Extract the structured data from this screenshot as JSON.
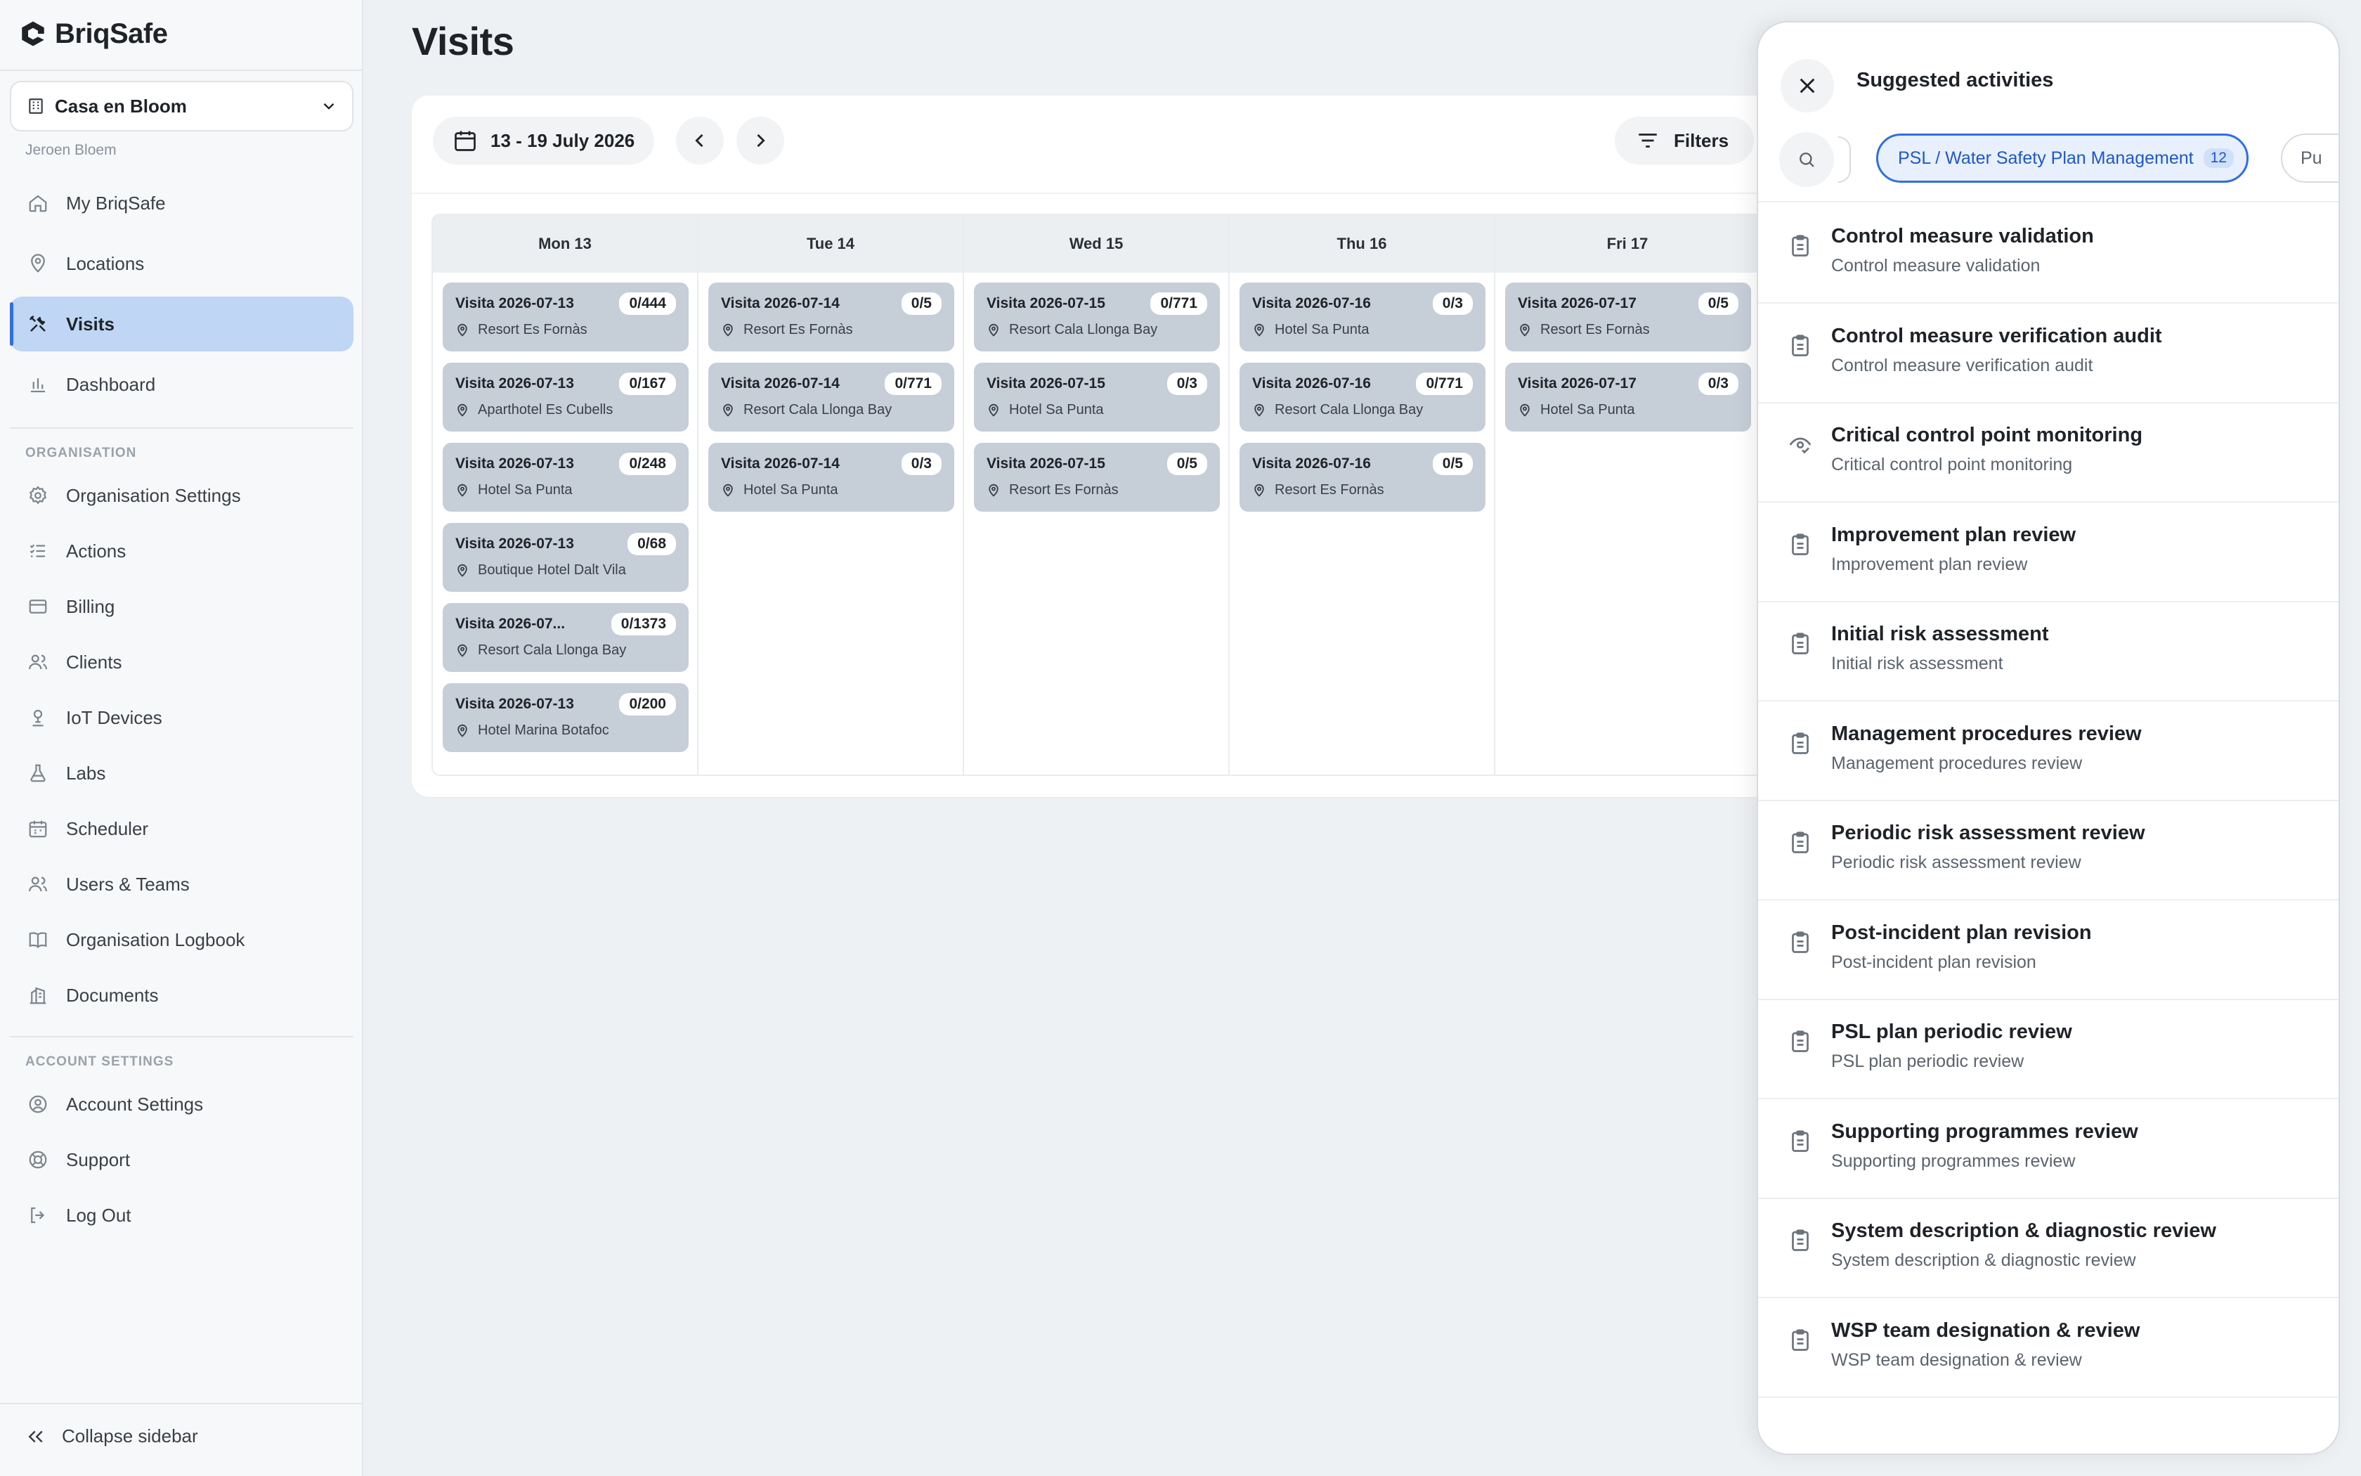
{
  "brand": {
    "name": "BriqSafe"
  },
  "org_switcher": {
    "name": "Casa en Bloom",
    "user": "Jeroen Bloem"
  },
  "nav": {
    "main": [
      {
        "label": "My BriqSafe",
        "icon": "home-icon"
      },
      {
        "label": "Locations",
        "icon": "map-pin-icon"
      },
      {
        "label": "Visits",
        "icon": "tools-icon",
        "active": true
      },
      {
        "label": "Dashboard",
        "icon": "bar-chart-icon"
      }
    ],
    "org_section": "ORGANISATION",
    "org": [
      {
        "label": "Organisation Settings",
        "icon": "gear-icon"
      },
      {
        "label": "Actions",
        "icon": "list-check-icon"
      },
      {
        "label": "Billing",
        "icon": "credit-card-icon"
      },
      {
        "label": "Clients",
        "icon": "users-icon"
      },
      {
        "label": "IoT Devices",
        "icon": "sensor-icon"
      },
      {
        "label": "Labs",
        "icon": "flask-icon"
      },
      {
        "label": "Scheduler",
        "icon": "calendar-icon"
      },
      {
        "label": "Users & Teams",
        "icon": "users-icon"
      },
      {
        "label": "Organisation Logbook",
        "icon": "book-icon"
      },
      {
        "label": "Documents",
        "icon": "building-icon"
      }
    ],
    "account_section": "ACCOUNT SETTINGS",
    "account": [
      {
        "label": "Account Settings",
        "icon": "user-circle-icon"
      },
      {
        "label": "Support",
        "icon": "lifebuoy-icon"
      },
      {
        "label": "Log Out",
        "icon": "logout-icon"
      }
    ],
    "collapse_label": "Collapse sidebar"
  },
  "page": {
    "title": "Visits"
  },
  "toolbar": {
    "date_range": "13 - 19 July 2026",
    "filters_label": "Filters"
  },
  "calendar": {
    "days": [
      {
        "label": "Mon 13",
        "visits": [
          {
            "title": "Visita 2026-07-13",
            "count": "0/444",
            "location": "Resort Es Fornàs"
          },
          {
            "title": "Visita 2026-07-13",
            "count": "0/167",
            "location": "Aparthotel Es Cubells"
          },
          {
            "title": "Visita 2026-07-13",
            "count": "0/248",
            "location": "Hotel Sa Punta"
          },
          {
            "title": "Visita 2026-07-13",
            "count": "0/68",
            "location": "Boutique Hotel Dalt Vila"
          },
          {
            "title": "Visita 2026-07...",
            "count": "0/1373",
            "location": "Resort Cala Llonga Bay"
          },
          {
            "title": "Visita 2026-07-13",
            "count": "0/200",
            "location": "Hotel Marina Botafoc"
          }
        ]
      },
      {
        "label": "Tue 14",
        "visits": [
          {
            "title": "Visita 2026-07-14",
            "count": "0/5",
            "location": "Resort Es Fornàs"
          },
          {
            "title": "Visita 2026-07-14",
            "count": "0/771",
            "location": "Resort Cala Llonga Bay"
          },
          {
            "title": "Visita 2026-07-14",
            "count": "0/3",
            "location": "Hotel Sa Punta"
          }
        ]
      },
      {
        "label": "Wed 15",
        "visits": [
          {
            "title": "Visita 2026-07-15",
            "count": "0/771",
            "location": "Resort Cala Llonga Bay"
          },
          {
            "title": "Visita 2026-07-15",
            "count": "0/3",
            "location": "Hotel Sa Punta"
          },
          {
            "title": "Visita 2026-07-15",
            "count": "0/5",
            "location": "Resort Es Fornàs"
          }
        ]
      },
      {
        "label": "Thu 16",
        "visits": [
          {
            "title": "Visita 2026-07-16",
            "count": "0/3",
            "location": "Hotel Sa Punta"
          },
          {
            "title": "Visita 2026-07-16",
            "count": "0/771",
            "location": "Resort Cala Llonga Bay"
          },
          {
            "title": "Visita 2026-07-16",
            "count": "0/5",
            "location": "Resort Es Fornàs"
          }
        ]
      },
      {
        "label": "Fri 17",
        "visits": [
          {
            "title": "Visita 2026-07-17",
            "count": "0/5",
            "location": "Resort Es Fornàs"
          },
          {
            "title": "Visita 2026-07-17",
            "count": "0/3",
            "location": "Hotel Sa Punta"
          }
        ]
      }
    ]
  },
  "panel": {
    "title": "Suggested activities",
    "filter_pill": {
      "label": "PSL / Water Safety Plan Management",
      "count": "12"
    },
    "next_pill_label": "Pu",
    "activities": [
      {
        "title": "Control measure validation",
        "subtitle": "Control measure validation",
        "icon": "clipboard-icon"
      },
      {
        "title": "Control measure verification audit",
        "subtitle": "Control measure verification audit",
        "icon": "clipboard-icon"
      },
      {
        "title": "Critical control point monitoring",
        "subtitle": "Critical control point monitoring",
        "icon": "eye-check-icon"
      },
      {
        "title": "Improvement plan review",
        "subtitle": "Improvement plan review",
        "icon": "clipboard-icon"
      },
      {
        "title": "Initial risk assessment",
        "subtitle": "Initial risk assessment",
        "icon": "clipboard-icon"
      },
      {
        "title": "Management procedures review",
        "subtitle": "Management procedures review",
        "icon": "clipboard-icon"
      },
      {
        "title": "Periodic risk assessment review",
        "subtitle": "Periodic risk assessment review",
        "icon": "clipboard-icon"
      },
      {
        "title": "Post-incident plan revision",
        "subtitle": "Post-incident plan revision",
        "icon": "clipboard-icon"
      },
      {
        "title": "PSL plan periodic review",
        "subtitle": "PSL plan periodic review",
        "icon": "clipboard-icon"
      },
      {
        "title": "Supporting programmes review",
        "subtitle": "Supporting programmes review",
        "icon": "clipboard-icon"
      },
      {
        "title": "System description & diagnostic review",
        "subtitle": "System description & diagnostic review",
        "icon": "clipboard-icon"
      },
      {
        "title": "WSP team designation & review",
        "subtitle": "WSP team designation & review",
        "icon": "clipboard-icon"
      }
    ]
  },
  "colors": {
    "accent": "#2f6fe0",
    "active_nav": "#bfd6f4",
    "visit_card": "#c6ced8",
    "background": "#eef1f4"
  }
}
